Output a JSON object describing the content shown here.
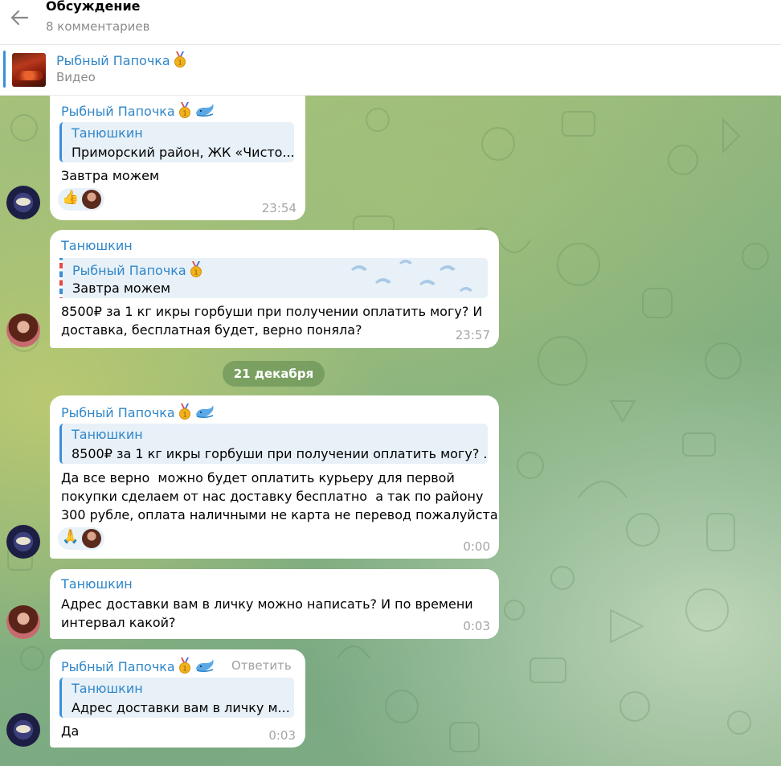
{
  "header": {
    "title": "Обсуждение",
    "subtitle": "8 комментариев"
  },
  "pinned": {
    "name": "Рыбный Папочка",
    "subtitle": "Видео"
  },
  "date_separator": "21 декабря",
  "messages": [
    {
      "sender": "Рыбный Папочка",
      "quote_name": "Танюшкин",
      "quote_text": "Приморский район, ЖК «Чисто...",
      "text": "Завтра можем",
      "reaction": "👍",
      "time": "23:54"
    },
    {
      "sender": "Танюшкин",
      "quote_name": "Рыбный Папочка",
      "quote_text": "Завтра можем",
      "text": "8500₽ за 1 кг икры горбуши при получении оплатить могу? И\nдоставка, бесплатная будет, верно поняла?",
      "time": "23:57"
    },
    {
      "sender": "Рыбный Папочка",
      "quote_name": "Танюшкин",
      "quote_text": "8500₽ за 1 кг икры горбуши при получении оплатить могу? ...",
      "text": "Да все верно  можно будет оплатить курьеру для первой\nпокупки сделаем от нас доставку бесплатно  а так по району\n300 рубле, оплата наличными не карта не перевод пожалуйста",
      "reaction": "🙏",
      "time": "0:00"
    },
    {
      "sender": "Танюшкин",
      "text": "Адрес доставки вам в личку можно написать? И по времени\nинтервал какой?",
      "time": "0:03"
    },
    {
      "sender": "Рыбный Папочка",
      "reply_label": "Ответить",
      "quote_name": "Танюшкин",
      "quote_text": "Адрес доставки вам в личку м...",
      "text": "Да",
      "time": "0:03"
    }
  ],
  "icons": {
    "back": "back-arrow-icon",
    "medal": "gold-medal-icon",
    "whale": "whale-icon"
  }
}
